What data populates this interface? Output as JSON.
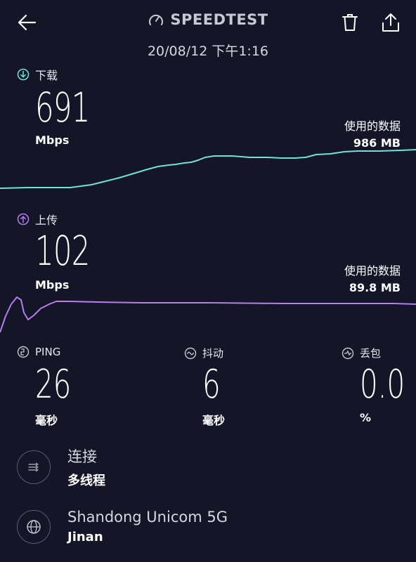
{
  "header": {
    "title": "SPEEDTEST",
    "datetime": "20/08/12 下午1:16"
  },
  "download": {
    "label": "下载",
    "value": "691",
    "unit": "Mbps",
    "data_used_label": "使用的数据",
    "data_used_value": "986 MB",
    "color": "#6fe3d8"
  },
  "upload": {
    "label": "上传",
    "value": "102",
    "unit": "Mbps",
    "data_used_label": "使用的数据",
    "data_used_value": "89.8 MB",
    "color": "#b67cf0"
  },
  "metrics": {
    "ping": {
      "label": "PING",
      "value": "26",
      "unit": "毫秒"
    },
    "jitter": {
      "label": "抖动",
      "value": "6",
      "unit": "毫秒"
    },
    "loss": {
      "label": "丢包",
      "value": "0.0",
      "unit": "%"
    }
  },
  "connection": {
    "title": "连接",
    "subtitle": "多线程"
  },
  "server": {
    "title": "Shandong Unicom 5G",
    "subtitle": "Jinan"
  },
  "icons": {
    "back": "back-arrow-icon",
    "speedometer": "speedometer-icon",
    "trash": "trash-icon",
    "share": "share-icon",
    "download": "download-arrow-icon",
    "upload": "upload-arrow-icon",
    "ping": "ping-icon",
    "jitter": "jitter-icon",
    "loss": "packet-loss-icon",
    "connection": "connections-icon",
    "globe": "globe-icon"
  }
}
